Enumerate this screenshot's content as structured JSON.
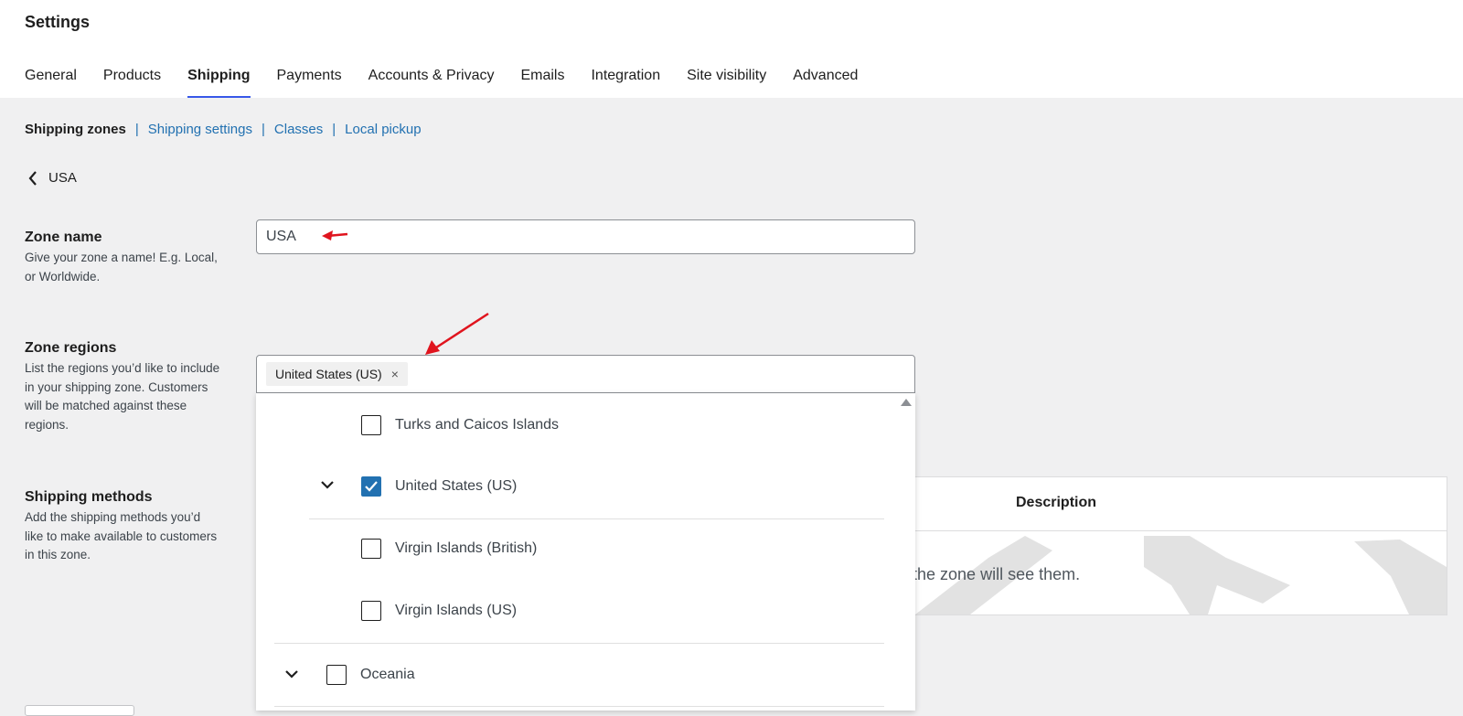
{
  "header": {
    "title": "Settings",
    "tabs": [
      {
        "label": "General",
        "active": false
      },
      {
        "label": "Products",
        "active": false
      },
      {
        "label": "Shipping",
        "active": true
      },
      {
        "label": "Payments",
        "active": false
      },
      {
        "label": "Accounts & Privacy",
        "active": false
      },
      {
        "label": "Emails",
        "active": false
      },
      {
        "label": "Integration",
        "active": false
      },
      {
        "label": "Site visibility",
        "active": false
      },
      {
        "label": "Advanced",
        "active": false
      }
    ]
  },
  "subnav": {
    "current": "Shipping zones",
    "links": [
      "Shipping settings",
      "Classes",
      "Local pickup"
    ],
    "separator": "|"
  },
  "back": {
    "label": "USA",
    "icon": "chevron-left-icon"
  },
  "zone_name": {
    "label": "Zone name",
    "help": "Give your zone a name! E.g. Local, or Worldwide.",
    "value": "USA"
  },
  "zone_regions": {
    "label": "Zone regions",
    "help": "List the regions you’d like to include in your shipping zone. Customers will be matched against these regions.",
    "selected_chip": "United States (US)",
    "chip_remove": "×",
    "options": [
      {
        "label": "Turks and Caicos Islands",
        "checked": false
      },
      {
        "label": "United States (US)",
        "checked": true
      },
      {
        "label": "Virgin Islands (British)",
        "checked": false
      },
      {
        "label": "Virgin Islands (US)",
        "checked": false
      },
      {
        "label": "Oceania",
        "checked": false
      }
    ]
  },
  "shipping_methods": {
    "label": "Shipping methods",
    "help": "Add the shipping methods you’d like to make available to customers in this zone.",
    "column_header": "Description",
    "empty_text": "in the zone will see them."
  },
  "colors": {
    "accent": "#3858e9",
    "link": "#2271b1",
    "checkbox_checked": "#2271b1",
    "annotation_arrow": "#e0141e"
  }
}
